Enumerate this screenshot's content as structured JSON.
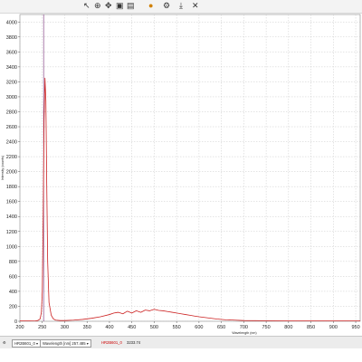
{
  "toolbar": {
    "icons": [
      "icon-a",
      "icon-b",
      "icon-c",
      "icon-d",
      "icon-e",
      "icon-f",
      "icon-g",
      "icon-h"
    ]
  },
  "chart_data": {
    "type": "line",
    "xlabel": "Wavelength (nm)",
    "ylabel": "Intensity (counts)",
    "xlim": [
      200,
      960
    ],
    "ylim": [
      0,
      4100
    ],
    "xticks": [
      200,
      250,
      300,
      350,
      400,
      450,
      500,
      550,
      600,
      650,
      700,
      750,
      800,
      850,
      900,
      950
    ],
    "yticks": [
      0,
      200,
      400,
      600,
      800,
      1000,
      1200,
      1400,
      1600,
      1800,
      2000,
      2200,
      2400,
      2600,
      2800,
      3000,
      3200,
      3400,
      3600,
      3800,
      4000
    ],
    "grid": true,
    "cursor_x": 253,
    "series": [
      {
        "color": "#cc2222",
        "x": [
          200,
          220,
          235,
          240,
          245,
          248,
          250,
          252,
          254,
          256,
          258,
          260,
          262,
          265,
          270,
          275,
          280,
          290,
          300,
          320,
          340,
          360,
          380,
          400,
          410,
          420,
          430,
          440,
          450,
          460,
          470,
          480,
          490,
          500,
          510,
          520,
          530,
          540,
          550,
          560,
          570,
          580,
          590,
          600,
          620,
          640,
          660,
          680,
          700,
          750,
          800,
          850,
          900,
          960
        ],
        "y": [
          5,
          5,
          6,
          10,
          30,
          120,
          400,
          1400,
          2700,
          3250,
          2950,
          1800,
          800,
          250,
          80,
          30,
          15,
          10,
          10,
          15,
          25,
          40,
          60,
          90,
          110,
          120,
          100,
          135,
          110,
          140,
          120,
          150,
          140,
          160,
          145,
          140,
          130,
          120,
          110,
          100,
          90,
          80,
          70,
          60,
          45,
          30,
          20,
          15,
          10,
          8,
          5,
          5,
          5,
          5
        ]
      }
    ]
  },
  "statusbar": {
    "dropdown_label": "HR2B601_0",
    "wavelength_label": "Wavelength [nm] 257.485",
    "series_label": "HR2B601_0",
    "value": "3233.74"
  }
}
